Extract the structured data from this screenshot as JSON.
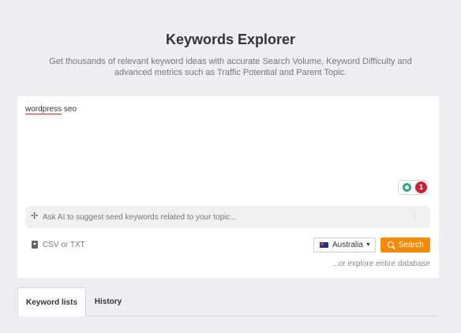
{
  "header": {
    "title": "Keywords Explorer",
    "subtitle": "Get thousands of relevant keyword ideas with accurate Search Volume, Keyword Difficulty and advanced metrics such as Traffic Potential and Parent Topic."
  },
  "editor": {
    "keyword_main": "wordpress",
    "keyword_rest": " seo",
    "suggestion_count": "1"
  },
  "ai": {
    "placeholder": "Ask AI to suggest seed keywords related to your topic..."
  },
  "upload": {
    "label": "CSV or TXT"
  },
  "country": {
    "name": "Australia"
  },
  "search": {
    "label": "Search"
  },
  "explore": {
    "label": "...or explore entire database"
  },
  "tabs": [
    {
      "label": "Keyword lists",
      "active": true
    },
    {
      "label": "History",
      "active": false
    }
  ],
  "colors": {
    "accent": "#f58a07",
    "badge": "#c8223a",
    "bulb": "#2ea77a"
  }
}
